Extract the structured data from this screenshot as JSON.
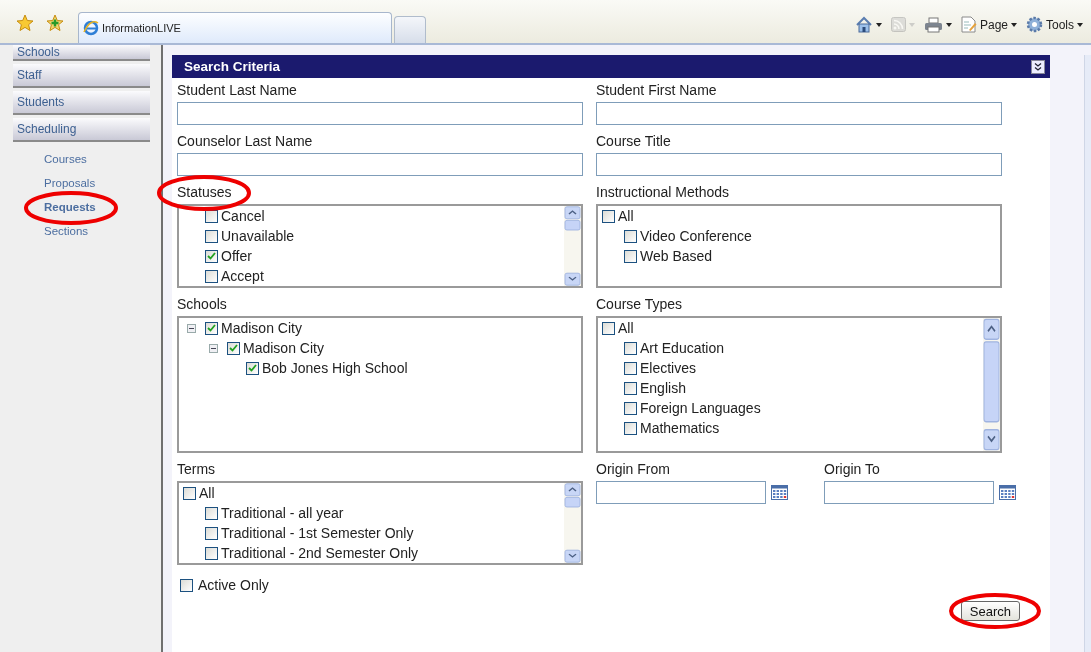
{
  "browser": {
    "tabs": [
      {
        "title": "InformationLIVE",
        "selected": true
      }
    ],
    "commands": [
      {
        "kind": "home",
        "dropdown": true,
        "disabled": false
      },
      {
        "kind": "feeds",
        "dropdown": true,
        "disabled": true
      },
      {
        "kind": "print",
        "dropdown": true,
        "disabled": false
      },
      {
        "kind": "page",
        "label": "Page",
        "dropdown": true,
        "disabled": false
      },
      {
        "kind": "tools",
        "label": "Tools",
        "dropdown": true,
        "disabled": false
      }
    ]
  },
  "sidebar": {
    "items": [
      {
        "label": "Schools"
      },
      {
        "label": "Staff"
      },
      {
        "label": "Students"
      },
      {
        "label": "Scheduling"
      }
    ],
    "subitems": [
      {
        "label": "Courses",
        "selected": false,
        "highlighted": false
      },
      {
        "label": "Proposals",
        "selected": false,
        "highlighted": false
      },
      {
        "label": "Requests",
        "selected": true,
        "highlighted": true
      },
      {
        "label": "Sections",
        "selected": false,
        "highlighted": false
      }
    ]
  },
  "panel": {
    "title": "Search Criteria"
  },
  "text_fields": [
    {
      "label": "Student Last Name"
    },
    {
      "label": "Student First Name"
    },
    {
      "label": "Counselor Last Name"
    },
    {
      "label": "Course Title"
    }
  ],
  "statuses": {
    "label": "Statuses",
    "highlighted": true,
    "items": [
      {
        "label": "Cancel",
        "checked": false
      },
      {
        "label": "Unavailable",
        "checked": false
      },
      {
        "label": "Offer",
        "checked": true
      },
      {
        "label": "Accept",
        "checked": false
      }
    ]
  },
  "instructional_methods": {
    "label": "Instructional Methods",
    "items": [
      {
        "label": "All",
        "checked": false,
        "children": [
          {
            "label": "Video Conference",
            "checked": false
          },
          {
            "label": "Web Based",
            "checked": false
          }
        ]
      }
    ]
  },
  "schools": {
    "label": "Schools",
    "items": [
      {
        "label": "Madison City",
        "checked": true,
        "expanded": true,
        "children": [
          {
            "label": "Madison City",
            "checked": true,
            "expanded": true,
            "children": [
              {
                "label": "Bob Jones High School",
                "checked": true
              }
            ]
          }
        ]
      }
    ]
  },
  "course_types": {
    "label": "Course Types",
    "items": [
      {
        "label": "All",
        "checked": false,
        "children": [
          {
            "label": "Art Education",
            "checked": false
          },
          {
            "label": "Electives",
            "checked": false
          },
          {
            "label": "English",
            "checked": false
          },
          {
            "label": "Foreign Languages",
            "checked": false
          },
          {
            "label": "Mathematics",
            "checked": false
          }
        ]
      }
    ]
  },
  "terms": {
    "label": "Terms",
    "items": [
      {
        "label": "All",
        "checked": false,
        "children": [
          {
            "label": "Traditional - all year",
            "checked": false
          },
          {
            "label": "Traditional - 1st Semester Only",
            "checked": false
          },
          {
            "label": "Traditional - 2nd Semester Only",
            "checked": false
          }
        ]
      }
    ]
  },
  "origin_from": {
    "label": "Origin From"
  },
  "origin_to": {
    "label": "Origin To"
  },
  "active_only": {
    "label": "Active Only",
    "checked": false
  },
  "search_button": {
    "label": "Search",
    "highlighted": true
  }
}
